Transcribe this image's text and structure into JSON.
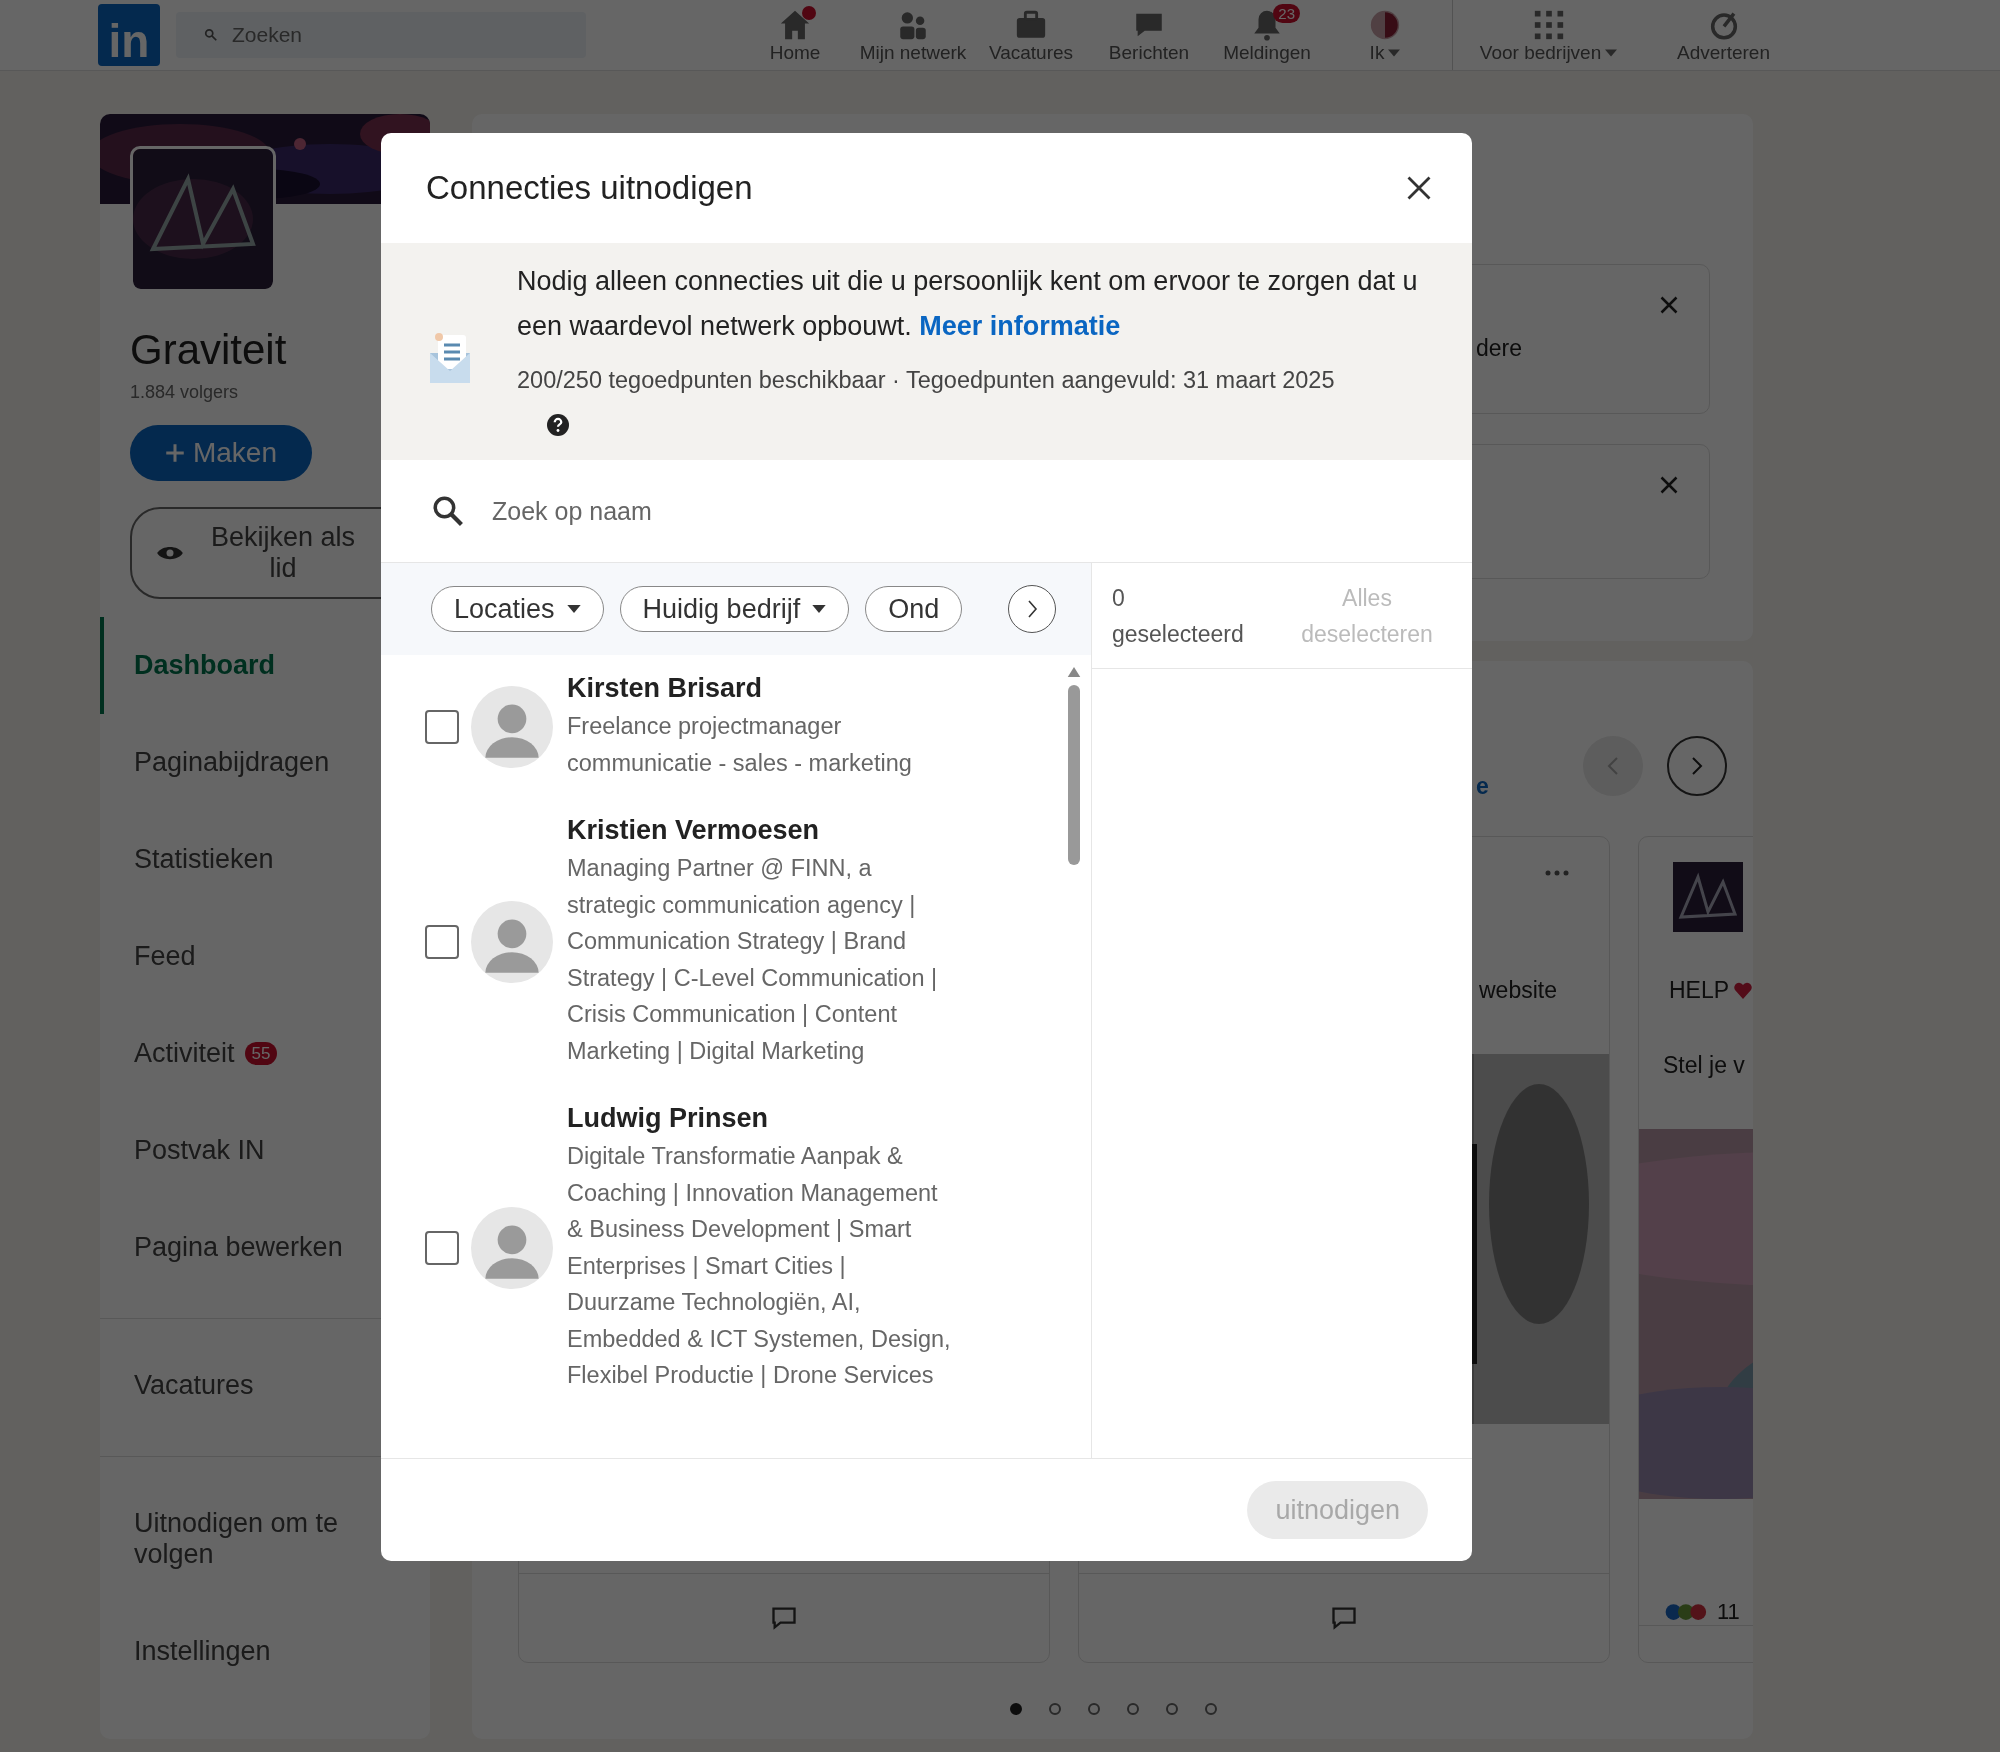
{
  "nav": {
    "logo": "in",
    "search_placeholder": "Zoeken",
    "items": [
      {
        "label": "Home",
        "kind": "home",
        "alert": true,
        "caret": false
      },
      {
        "label": "Mijn netwerk",
        "kind": "network",
        "alert": false,
        "caret": false
      },
      {
        "label": "Vacatures",
        "kind": "jobs",
        "alert": false,
        "caret": false
      },
      {
        "label": "Berichten",
        "kind": "messages",
        "alert": false,
        "caret": false
      },
      {
        "label": "Meldingen",
        "kind": "bell",
        "alert": false,
        "caret": false,
        "badge": "23"
      },
      {
        "label": "Ik",
        "kind": "avatar",
        "alert": false,
        "caret": true
      }
    ],
    "business_items": [
      {
        "label": "Voor bedrijven",
        "kind": "grid",
        "caret": true
      },
      {
        "label": "Adverteren",
        "kind": "ad",
        "caret": false
      }
    ]
  },
  "sidebar": {
    "page_name": "Graviteit",
    "followers": "1.884 volgers",
    "create_button": "Maken",
    "view_button": "Bekijken als lid",
    "menu_groups": [
      {
        "items": [
          {
            "label": "Dashboard",
            "selected": true
          },
          {
            "label": "Paginabijdragen",
            "selected": false
          },
          {
            "label": "Statistieken",
            "selected": false
          },
          {
            "label": "Feed",
            "selected": false
          },
          {
            "label": "Activiteit",
            "selected": false,
            "badge": "55"
          },
          {
            "label": "Postvak IN",
            "selected": false
          },
          {
            "label": "Pagina bewerken",
            "selected": false
          }
        ]
      },
      {
        "items": [
          {
            "label": "Vacatures",
            "selected": false
          }
        ]
      },
      {
        "items": [
          {
            "label": "Uitnodigen om te volgen",
            "selected": false
          },
          {
            "label": "Instellingen",
            "selected": false
          }
        ]
      }
    ]
  },
  "background": {
    "suggestions": [
      {
        "text": "dere",
        "dismissible": true
      },
      {
        "dismissible": true
      }
    ],
    "carousel": {
      "link": "e",
      "prev_disabled": true,
      "posts": [
        {
          "kind": "blank"
        },
        {
          "kind": "post",
          "text": "website"
        },
        {
          "kind": "logo_post",
          "text": "HELP",
          "subtext": "Stel je v",
          "reactions": "11"
        }
      ],
      "dots": [
        {
          "selected": true
        },
        {
          "selected": false
        },
        {
          "selected": false
        },
        {
          "selected": false
        },
        {
          "selected": false
        },
        {
          "selected": false
        }
      ]
    }
  },
  "modal": {
    "title": "Connecties uitnodigen",
    "notice": {
      "text": "Nodig alleen connecties uit die u persoonlijk kent om ervoor te zorgen dat u een waardevol netwerk opbouwt.",
      "link": "Meer informatie",
      "credits": "200/250 tegoedpunten beschikbaar · Tegoedpunten aangevuld: 31 maart 2025"
    },
    "search": {
      "placeholder": "Zoek op naam"
    },
    "filters": [
      {
        "label": "Locaties",
        "dropdown": true
      },
      {
        "label": "Huidig bedrijf",
        "dropdown": true
      },
      {
        "label": "Ond",
        "dropdown": false
      }
    ],
    "selected_count": "0 geselecteerd",
    "deselect_all": {
      "label": "Alles deselecteren",
      "disabled": true
    },
    "people": [
      {
        "name": "Kirsten Brisard",
        "headline": "Freelance projectmanager communicatie - sales - marketing",
        "checked": false
      },
      {
        "name": "Kristien Vermoesen",
        "headline": "Managing Partner @ FINN, a strategic communication agency | Communication Strategy | Brand Strategy | C-Level Communication | Crisis Communication | Content Marketing | Digital Marketing",
        "checked": false
      },
      {
        "name": "Ludwig Prinsen",
        "headline": "Digitale Transformatie Aanpak & Coaching | Innovation Management & Business Development | Smart Enterprises | Smart Cities | Duurzame Technologiën, AI, Embedded & ICT Systemen, Design, Flexibel Productie | Drone Services",
        "checked": false
      }
    ],
    "invite_button": {
      "label": "uitnodigen",
      "disabled": true
    }
  }
}
